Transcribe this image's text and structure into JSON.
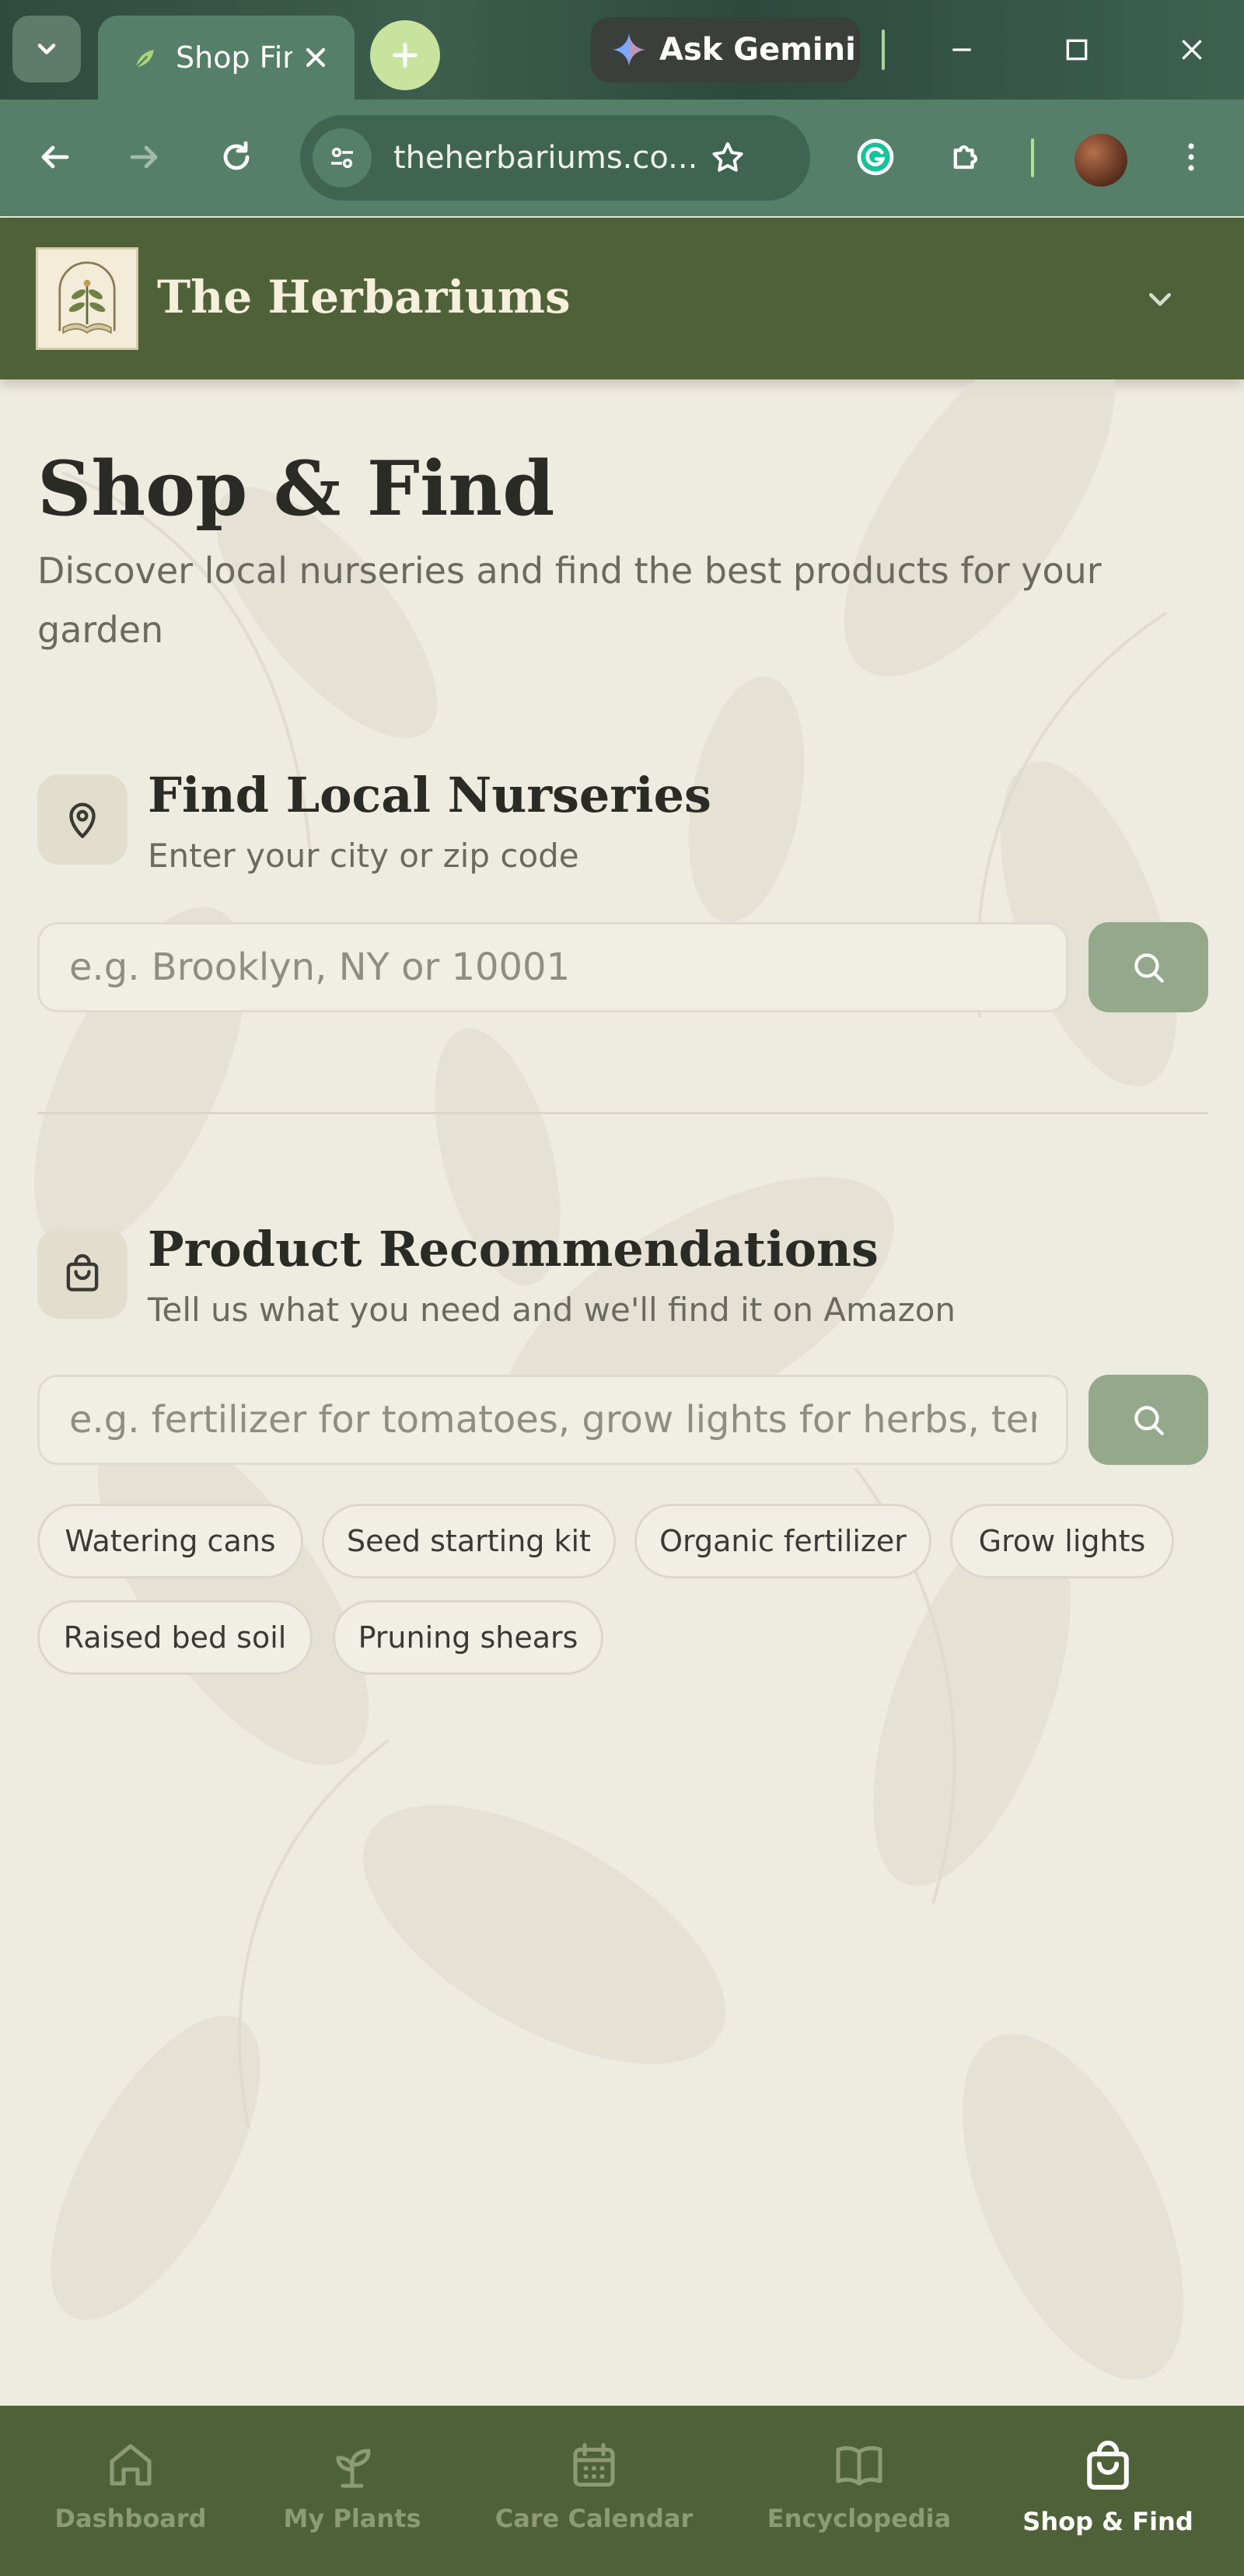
{
  "browser": {
    "tab_title": "Shop Find",
    "gemini_label": "Ask Gemini",
    "url": "theherbariums.co..."
  },
  "site": {
    "brand": "The Herbariums"
  },
  "page": {
    "title": "Shop & Find",
    "subtitle": "Discover local nurseries and find the best products for your garden"
  },
  "nurseries": {
    "title": "Find Local Nurseries",
    "subtitle": "Enter your city or zip code",
    "placeholder": "e.g. Brooklyn, NY or 10001"
  },
  "products": {
    "title": "Product Recommendations",
    "subtitle": "Tell us what you need and we'll find it on Amazon",
    "placeholder": "e.g. fertilizer for tomatoes, grow lights for herbs, terrarium supplies",
    "chips": [
      "Watering cans",
      "Seed starting kit",
      "Organic fertilizer",
      "Grow lights",
      "Raised bed soil",
      "Pruning shears"
    ]
  },
  "nav": {
    "items": [
      {
        "label": "Dashboard",
        "icon": "home-icon"
      },
      {
        "label": "My Plants",
        "icon": "sprout-icon"
      },
      {
        "label": "Care Calendar",
        "icon": "calendar-icon"
      },
      {
        "label": "Encyclopedia",
        "icon": "book-icon"
      },
      {
        "label": "Shop & Find",
        "icon": "shopping-bag-icon",
        "active": true
      }
    ]
  },
  "colors": {
    "header": "#4f6138",
    "background": "#eeebe1",
    "search_button": "#94a88b",
    "toolbar": "#557f68"
  }
}
